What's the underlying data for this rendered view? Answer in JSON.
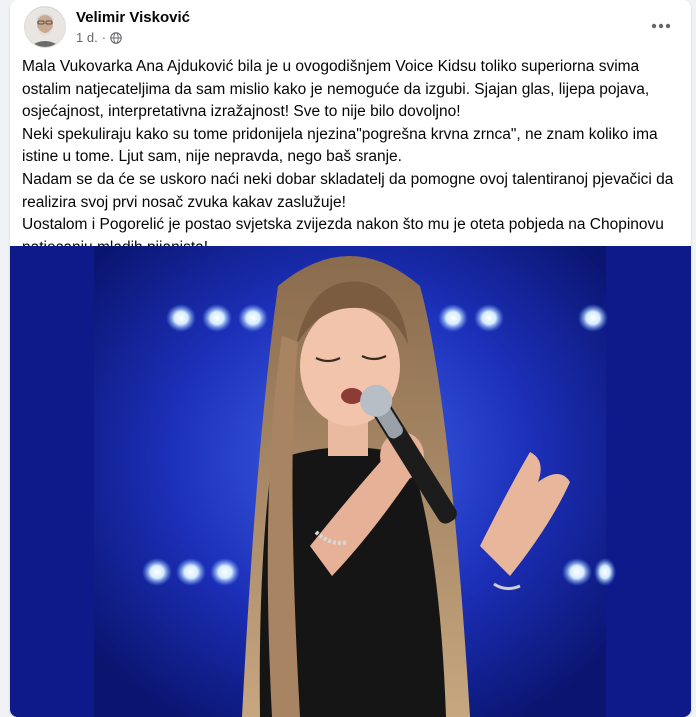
{
  "post": {
    "author": "Velimir Visković",
    "time": "1 d.",
    "separator": "·",
    "more_icon": "more-horizontal-icon",
    "audience_icon": "globe-icon",
    "paragraphs": [
      "Mala Vukovarka Ana Ajduković bila je u ovogodišnjem Voice Kidsu toliko superiorna svima ostalim natjecateljima da sam mislio kako je nemoguće da izgubi. Sjajan glas, lijepa pojava, osjećajnost, interpretativna izražajnost! Sve to nije bilo dovoljno!",
      "Neki spekuliraju kako su tome pridonijela njezina\"pogrešna krvna zrnca\", ne znam koliko ima istine u tome. Ljut sam, nije nepravda, nego baš sranje.",
      "Nadam se da će se uskoro naći neki dobar skladatelj da pomogne ovoj talentiranoj pjevačici da realizira svoj prvi nosač zvuka kakav zaslužuje!",
      "Uostalom i Pogorelić je postao svjetska zvijezda nakon što mu je oteta pobjeda na Chopinovu natjecanju mladih pijanista!"
    ]
  },
  "colors": {
    "card": "#ffffff",
    "page_bg": "#f0f2f5",
    "secondary_text": "#65676b",
    "photo_bg": "#0e1a8a"
  }
}
